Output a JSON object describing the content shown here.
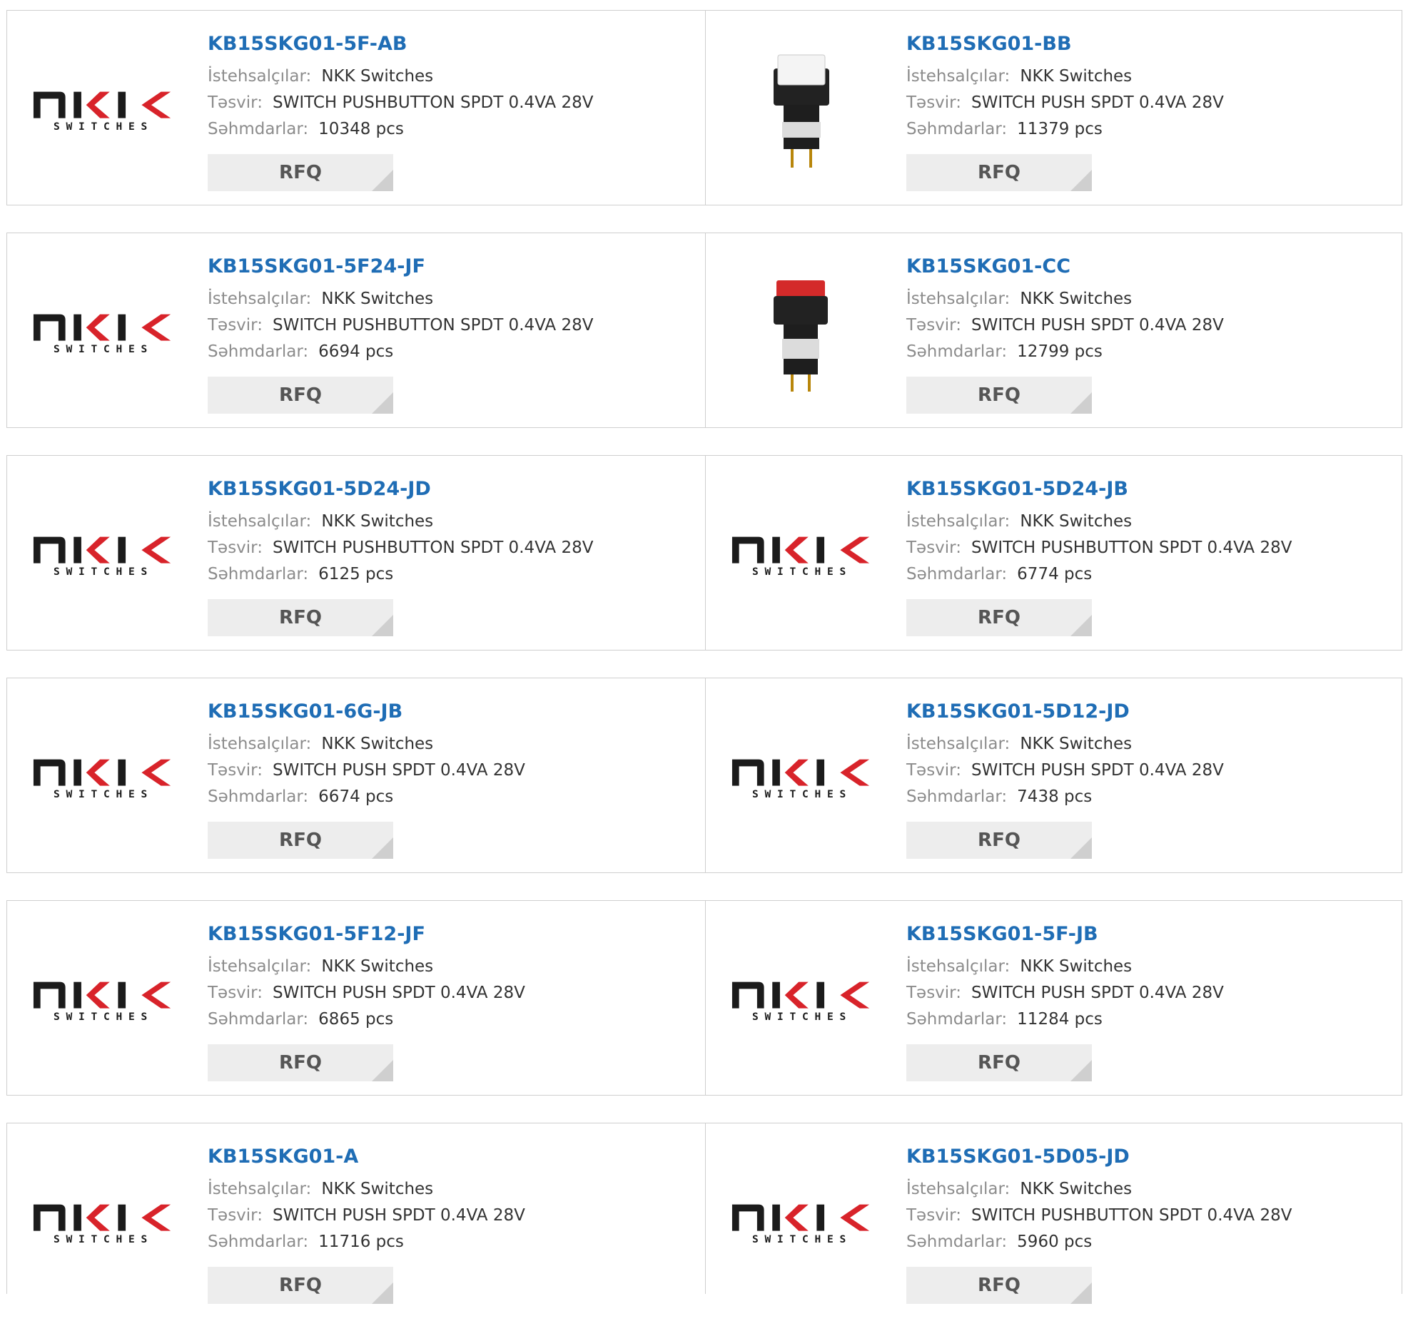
{
  "rfq_label": "RFQ",
  "labels": {
    "manufacturer": "İstehsalçılar:",
    "description": "Təsvir:",
    "stock": "Səhmdarlar:"
  },
  "logo": {
    "top_text": "NKK",
    "bottom_text": "SWITCHES",
    "colors": {
      "dark": "#1b1b1b",
      "red": "#d8232a"
    }
  },
  "accent": "#1f6db5",
  "products": [
    {
      "part": "KB15SKG01-5F-AB",
      "manufacturer": "NKK Switches",
      "description": "SWITCH PUSHBUTTON SPDT 0.4VA 28V",
      "stock": "10348 pcs",
      "image": "nkk-logo-icon"
    },
    {
      "part": "KB15SKG01-BB",
      "manufacturer": "NKK Switches",
      "description": "SWITCH PUSH SPDT 0.4VA 28V",
      "stock": "11379 pcs",
      "image": "white-pushbutton-icon"
    },
    {
      "part": "KB15SKG01-5F24-JF",
      "manufacturer": "NKK Switches",
      "description": "SWITCH PUSHBUTTON SPDT 0.4VA 28V",
      "stock": "6694 pcs",
      "image": "nkk-logo-icon"
    },
    {
      "part": "KB15SKG01-CC",
      "manufacturer": "NKK Switches",
      "description": "SWITCH PUSH SPDT 0.4VA 28V",
      "stock": "12799 pcs",
      "image": "red-pushbutton-icon"
    },
    {
      "part": "KB15SKG01-5D24-JD",
      "manufacturer": "NKK Switches",
      "description": "SWITCH PUSHBUTTON SPDT 0.4VA 28V",
      "stock": "6125 pcs",
      "image": "nkk-logo-icon"
    },
    {
      "part": "KB15SKG01-5D24-JB",
      "manufacturer": "NKK Switches",
      "description": "SWITCH PUSHBUTTON SPDT 0.4VA 28V",
      "stock": "6774 pcs",
      "image": "nkk-logo-icon"
    },
    {
      "part": "KB15SKG01-6G-JB",
      "manufacturer": "NKK Switches",
      "description": "SWITCH PUSH SPDT 0.4VA 28V",
      "stock": "6674 pcs",
      "image": "nkk-logo-icon"
    },
    {
      "part": "KB15SKG01-5D12-JD",
      "manufacturer": "NKK Switches",
      "description": "SWITCH PUSH SPDT 0.4VA 28V",
      "stock": "7438 pcs",
      "image": "nkk-logo-icon"
    },
    {
      "part": "KB15SKG01-5F12-JF",
      "manufacturer": "NKK Switches",
      "description": "SWITCH PUSH SPDT 0.4VA 28V",
      "stock": "6865 pcs",
      "image": "nkk-logo-icon"
    },
    {
      "part": "KB15SKG01-5F-JB",
      "manufacturer": "NKK Switches",
      "description": "SWITCH PUSH SPDT 0.4VA 28V",
      "stock": "11284 pcs",
      "image": "nkk-logo-icon"
    },
    {
      "part": "KB15SKG01-A",
      "manufacturer": "NKK Switches",
      "description": "SWITCH PUSH SPDT 0.4VA 28V",
      "stock": "11716 pcs",
      "image": "nkk-logo-icon"
    },
    {
      "part": "KB15SKG01-5D05-JD",
      "manufacturer": "NKK Switches",
      "description": "SWITCH PUSHBUTTON SPDT 0.4VA 28V",
      "stock": "5960 pcs",
      "image": "nkk-logo-icon"
    }
  ]
}
